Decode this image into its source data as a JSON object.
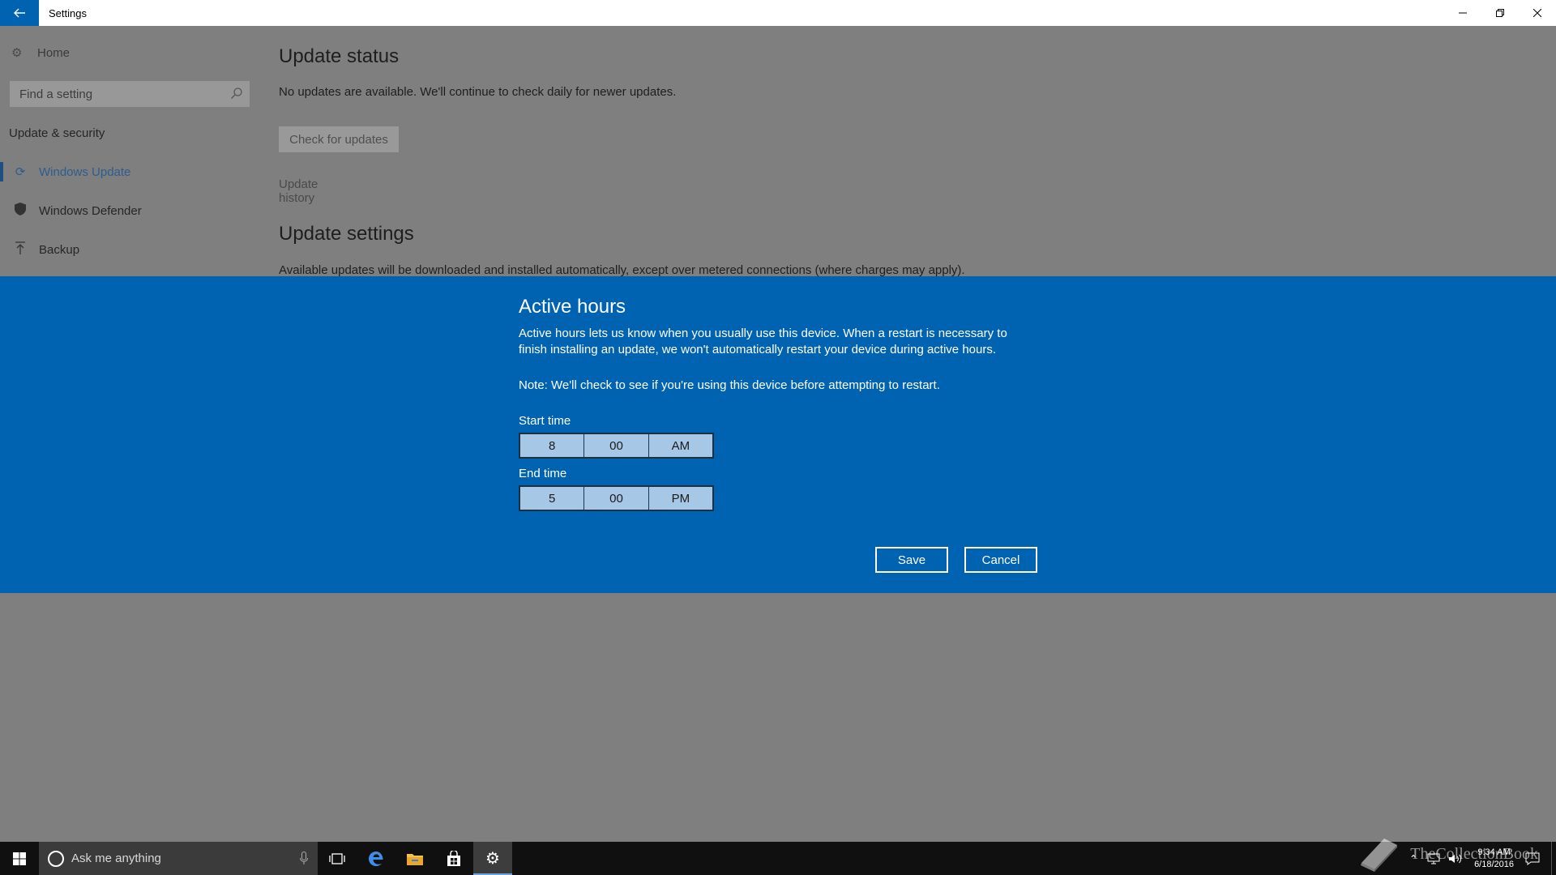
{
  "window": {
    "title": "Settings",
    "back_icon": "arrow-left-icon",
    "controls": [
      "minimize-icon",
      "restore-icon",
      "close-icon"
    ]
  },
  "sidebar": {
    "home_label": "Home",
    "search_placeholder": "Find a setting",
    "section_title": "Update & security",
    "items": [
      {
        "label": "Windows Update",
        "icon": "refresh-icon",
        "active": true
      },
      {
        "label": "Windows Defender",
        "icon": "shield-icon",
        "active": false
      },
      {
        "label": "Backup",
        "icon": "upload-arrow-icon",
        "active": false
      }
    ]
  },
  "main": {
    "update_status_heading": "Update status",
    "update_status_text": "No updates are available. We'll continue to check daily for newer updates.",
    "check_button": "Check for updates",
    "history_link": "Update history",
    "update_settings_heading": "Update settings",
    "update_settings_text": "Available updates will be downloaded and installed automatically, except over metered connections (where charges may apply)."
  },
  "dialog": {
    "title": "Active hours",
    "body": "Active hours lets us know when you usually use this device. When a restart is necessary to finish installing an update, we won't automatically restart your device during active hours.",
    "note": "Note: We'll check to see if you're using this device before attempting to restart.",
    "start_label": "Start time",
    "start": {
      "hour": "8",
      "minute": "00",
      "period": "AM"
    },
    "end_label": "End time",
    "end": {
      "hour": "5",
      "minute": "00",
      "period": "PM"
    },
    "save_label": "Save",
    "cancel_label": "Cancel",
    "accent_color": "#0063b1"
  },
  "taskbar": {
    "search_placeholder": "Ask me anything",
    "pinned": [
      "task-view-icon",
      "edge-icon",
      "file-explorer-icon",
      "store-icon",
      "settings-icon"
    ],
    "clock_time": "9:34 AM",
    "clock_date": "6/18/2016"
  },
  "watermark_text": "TheCollectionBook"
}
